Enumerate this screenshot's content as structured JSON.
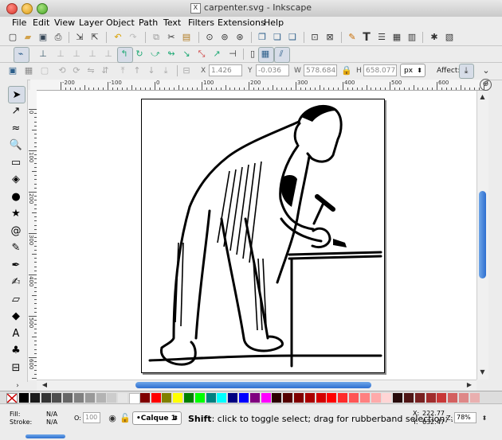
{
  "window": {
    "title": "carpenter.svg - Inkscape"
  },
  "menu": [
    "File",
    "Edit",
    "View",
    "Layer",
    "Object",
    "Path",
    "Text",
    "Filters",
    "Extensions",
    "Help"
  ],
  "toolbar": {
    "x_label": "X",
    "x_value": "1.426",
    "y_label": "Y",
    "y_value": "-0.036",
    "w_label": "W",
    "w_value": "578.684",
    "h_label": "H",
    "h_value": "658.077",
    "unit": "px",
    "affect_label": "Affect:"
  },
  "ruler": {
    "h_labels": [
      "-200",
      "-100",
      "0",
      "100",
      "200",
      "300",
      "400",
      "500",
      "600",
      "700"
    ],
    "v_labels": [
      "0",
      "100",
      "200",
      "300",
      "400",
      "500",
      "600"
    ]
  },
  "tools": [
    {
      "name": "selector-tool",
      "glyph": "➤"
    },
    {
      "name": "node-tool",
      "glyph": "↗"
    },
    {
      "name": "tweak-tool",
      "glyph": "≈"
    },
    {
      "name": "zoom-tool",
      "glyph": "🔍"
    },
    {
      "name": "rect-tool",
      "glyph": "▭"
    },
    {
      "name": "3dbox-tool",
      "glyph": "◈"
    },
    {
      "name": "ellipse-tool",
      "glyph": "●"
    },
    {
      "name": "star-tool",
      "glyph": "★"
    },
    {
      "name": "spiral-tool",
      "glyph": "@"
    },
    {
      "name": "pencil-tool",
      "glyph": "✎"
    },
    {
      "name": "pen-tool",
      "glyph": "✒"
    },
    {
      "name": "calligraphy-tool",
      "glyph": "✍"
    },
    {
      "name": "eraser-tool",
      "glyph": "▱"
    },
    {
      "name": "bucket-tool",
      "glyph": "◆"
    },
    {
      "name": "text-tool",
      "glyph": "A"
    },
    {
      "name": "spray-tool",
      "glyph": "♣"
    },
    {
      "name": "connector-tool",
      "glyph": "⊟"
    }
  ],
  "palette_colors": [
    "#000000",
    "#1a1a1a",
    "#333333",
    "#4d4d4d",
    "#666666",
    "#808080",
    "#999999",
    "#b3b3b3",
    "#cccccc",
    "#e6e6e6",
    "#ffffff",
    "#800000",
    "#ff0000",
    "#808000",
    "#ffff00",
    "#008000",
    "#00ff00",
    "#008080",
    "#00ffff",
    "#000080",
    "#0000ff",
    "#800080",
    "#ff00ff",
    "#2b0000",
    "#550000",
    "#800000",
    "#aa0000",
    "#d40000",
    "#ff0000",
    "#ff2a2a",
    "#ff5555",
    "#ff8080",
    "#ffaaaa",
    "#ffd5d5",
    "#280b0b",
    "#501616",
    "#782121",
    "#a02c2c",
    "#c83737",
    "#d35f5f",
    "#de8787",
    "#e9afaf"
  ],
  "status": {
    "fill_label": "Fill:",
    "fill_value": "N/A",
    "stroke_label": "Stroke:",
    "stroke_value": "N/A",
    "opacity_label": "O:",
    "opacity_value": "100",
    "layer": "•Calque 1",
    "message_bold": "Shift",
    "message": ": click to toggle select; drag for rubberband selection; ...",
    "x_label": "X:",
    "x": "222.77",
    "y_label": "Y:",
    "y": "632.47",
    "zoom_label": "Z:",
    "zoom": "78%"
  }
}
